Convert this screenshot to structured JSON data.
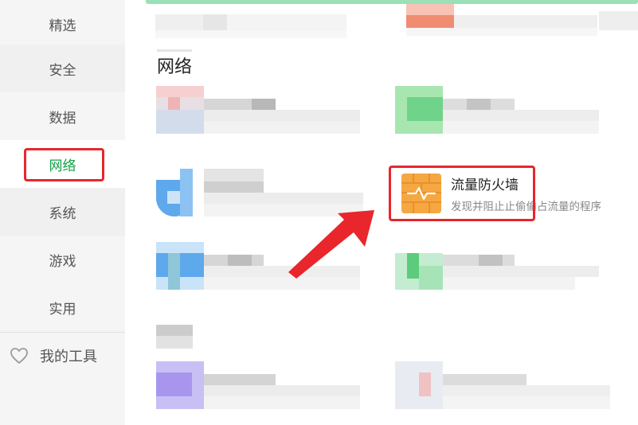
{
  "sidebar": {
    "items": [
      {
        "label": "精选"
      },
      {
        "label": "安全"
      },
      {
        "label": "数据"
      },
      {
        "label": "网络"
      },
      {
        "label": "系统"
      },
      {
        "label": "游戏"
      },
      {
        "label": "实用"
      }
    ],
    "active_index": 3,
    "my_tools_label": "我的工具",
    "active_color": "#14a048"
  },
  "main": {
    "section_title": "网络",
    "highlighted_tool": {
      "name": "流量防火墙",
      "description": "发现并阻止止偷偷占流量的程序",
      "icon": "firewall-icon",
      "icon_color": "#f5a742"
    }
  },
  "annotations": {
    "highlight_color": "#e8262c"
  }
}
